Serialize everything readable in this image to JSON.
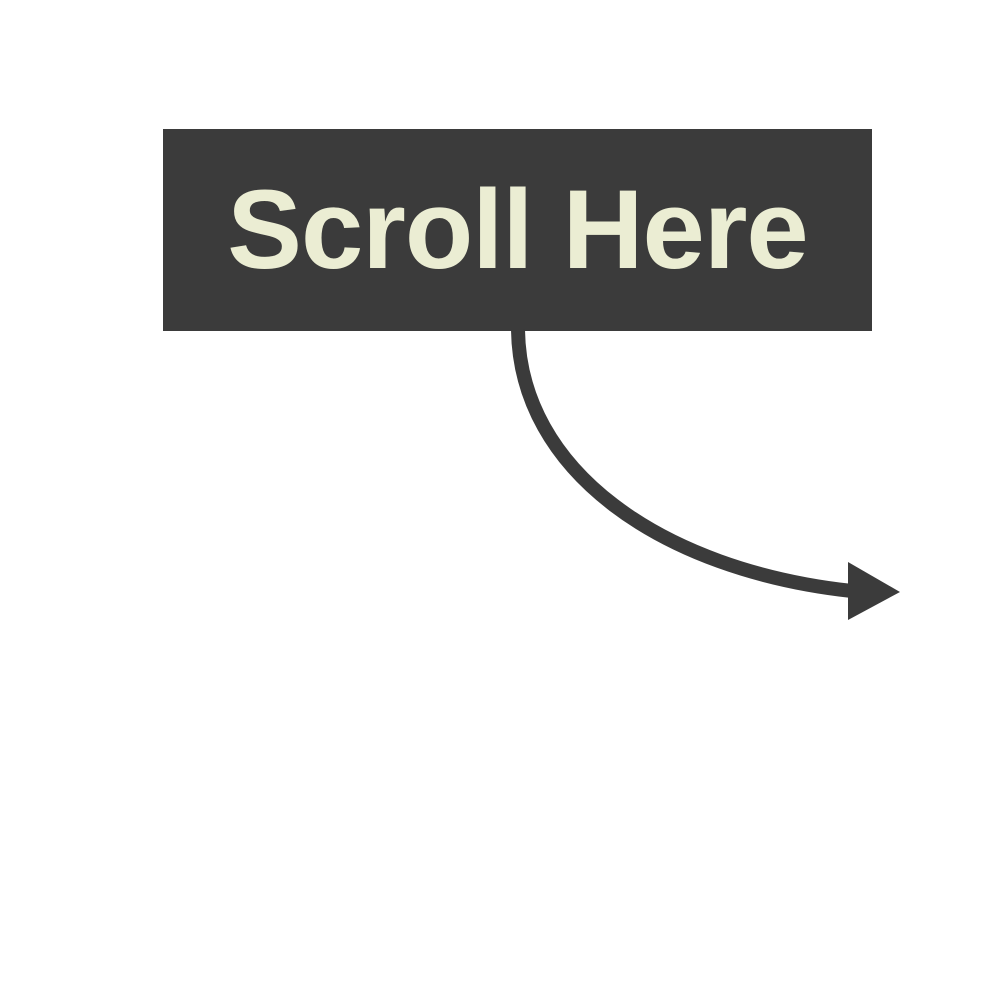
{
  "hint": {
    "label": "Scroll Here",
    "icon": "curved-arrow-right-icon"
  },
  "colors": {
    "background": "#ffffff",
    "box": "#3b3b3b",
    "text": "#ebedd3",
    "arrow": "#3b3b3b"
  }
}
